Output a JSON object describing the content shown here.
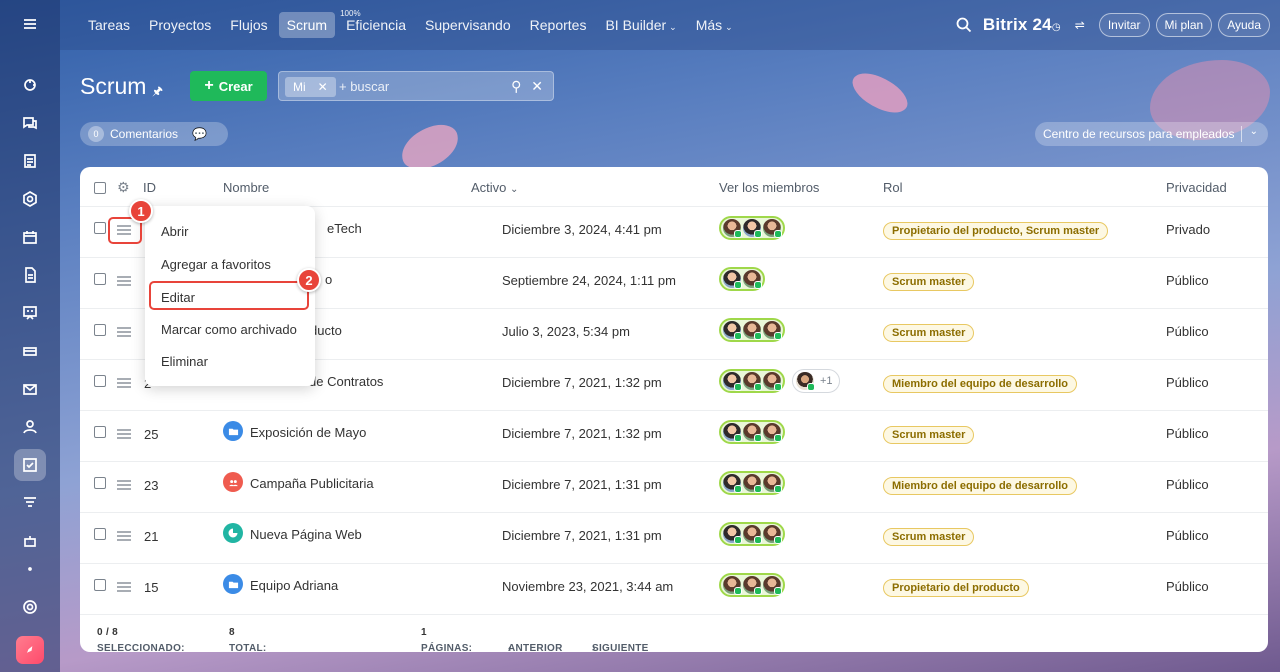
{
  "topnav": {
    "items": [
      {
        "label": "Tareas",
        "active": false
      },
      {
        "label": "Proyectos",
        "active": false
      },
      {
        "label": "Flujos",
        "active": false
      },
      {
        "label": "Scrum",
        "active": true
      },
      {
        "label": "Eficiencia",
        "badge": "100%",
        "active": false
      },
      {
        "label": "Supervisando",
        "active": false
      },
      {
        "label": "Reportes",
        "active": false
      },
      {
        "label": "BI Builder",
        "dropdown": true,
        "active": false
      },
      {
        "label": "Más",
        "dropdown": true,
        "active": false
      }
    ],
    "brand": "Bitrix",
    "brand_suffix": "24",
    "invite_label": "Invitar",
    "plan_label": "Mi plan",
    "help_label": "Ayuda"
  },
  "page": {
    "title": "Scrum",
    "create_label": "Crear",
    "filter_chip": "Mi",
    "search_placeholder": "+ buscar",
    "comments_count": "0",
    "comments_label": "Comentarios",
    "resources_label": "Centro de recursos para empleados"
  },
  "grid": {
    "columns": {
      "id": "ID",
      "name": "Nombre",
      "active": "Activo",
      "members": "Ver los miembros",
      "role": "Rol",
      "privacy": "Privacidad"
    },
    "rows": [
      {
        "id": "",
        "name": "eTech",
        "date": "Diciembre 3, 2024, 4:41 pm",
        "role": "Propietario del producto, Scrum master",
        "privacy": "Privado"
      },
      {
        "id": "",
        "name": "o",
        "date": "Septiembre 24, 2024, 1:11 pm",
        "role": "Scrum master",
        "privacy": "Público"
      },
      {
        "id": "",
        "name": "ducto",
        "date": "Julio 3, 2023, 5:34 pm",
        "role": "Scrum master",
        "privacy": "Público"
      },
      {
        "id": "2",
        "name": "de Contratos",
        "date": "Diciembre 7, 2021, 1:32 pm",
        "role": "Miembro del equipo de desarrollo",
        "privacy": "Público",
        "extra": "+1"
      },
      {
        "id": "25",
        "name": "Exposición de Mayo",
        "date": "Diciembre 7, 2021, 1:32 pm",
        "role": "Scrum master",
        "privacy": "Público"
      },
      {
        "id": "23",
        "name": "Campaña Publicitaria",
        "date": "Diciembre 7, 2021, 1:31 pm",
        "role": "Miembro del equipo de desarrollo",
        "privacy": "Público"
      },
      {
        "id": "21",
        "name": "Nueva Página Web",
        "date": "Diciembre 7, 2021, 1:31 pm",
        "role": "Scrum master",
        "privacy": "Público"
      },
      {
        "id": "15",
        "name": "Equipo Adriana",
        "date": "Noviembre 23, 2021, 3:44 am",
        "role": "Propietario del producto",
        "privacy": "Público"
      }
    ],
    "footer": {
      "selected_label": "SELECCIONADO:",
      "selected_value": "0 / 8",
      "total_label": "TOTAL:",
      "total_value": "8",
      "pages_label": "PÁGINAS:",
      "pages_value": "1",
      "prev_label": "ANTERIOR",
      "next_label": "SIGUIENTE"
    }
  },
  "context_menu": {
    "items": [
      "Abrir",
      "Agregar a favoritos",
      "Editar",
      "Marcar como archivado",
      "Eliminar"
    ]
  },
  "annotations": {
    "step1": "1",
    "step2": "2",
    "highlight_color": "#e8443a"
  },
  "colors": {
    "accent_green": "#1fb95a",
    "role_badge_text": "#8c6d00",
    "role_badge_border": "#e8c862"
  }
}
